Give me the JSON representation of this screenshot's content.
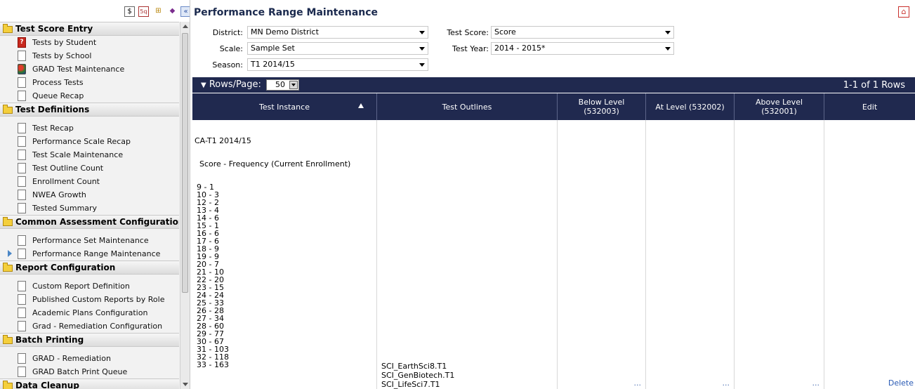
{
  "sidebar": {
    "toolbar": [
      {
        "icon": "dollar-icon",
        "glyph": "$"
      },
      {
        "icon": "report-icon",
        "glyph": "5q"
      },
      {
        "icon": "database-icon",
        "glyph": "⊞"
      },
      {
        "icon": "book-icon",
        "glyph": "◆"
      },
      {
        "icon": "collapse-icon",
        "glyph": "«"
      }
    ],
    "sections": [
      {
        "title": "Test Score Entry",
        "items": [
          "Tests by Student",
          "Tests by School",
          "GRAD Test Maintenance",
          "Process Tests",
          "Queue Recap"
        ]
      },
      {
        "title": "Test Definitions",
        "items": [
          "Test Recap",
          "Performance Scale Recap",
          "Test Scale Maintenance",
          "Test Outline Count",
          "Enrollment Count",
          "NWEA Growth",
          "Tested Summary"
        ]
      },
      {
        "title": "Common Assessment Configuration",
        "items": [
          "Performance Set Maintenance",
          "Performance Range Maintenance"
        ]
      },
      {
        "title": "Report Configuration",
        "items": [
          "Custom Report Definition",
          "Published Custom Reports by Role",
          "Academic Plans Configuration",
          "Grad - Remediation Configuration"
        ]
      },
      {
        "title": "Batch Printing",
        "items": [
          "GRAD - Remediation",
          "GRAD Batch Print Queue"
        ]
      },
      {
        "title": "Data Cleanup",
        "items": []
      }
    ]
  },
  "page": {
    "title": "Performance Range Maintenance"
  },
  "filters": {
    "district_label": "District:",
    "district_value": "MN Demo District",
    "scale_label": "Scale:",
    "scale_value": "Sample Set",
    "season_label": "Season:",
    "season_value": "T1 2014/15",
    "test_score_label": "Test Score:",
    "test_score_value": "Score",
    "test_year_label": "Test Year:",
    "test_year_value": "2014 - 2015*"
  },
  "grid": {
    "rows_label": "Rows/Page:",
    "rows_per_page": "50",
    "rows_count": "1-1 of 1 Rows",
    "columns": [
      "Test Instance",
      "Test Outlines",
      "Below Level\n(532003)",
      "At Level (532002)",
      "Above Level\n(532001)",
      "Edit"
    ],
    "row": {
      "test_instance": "CA-T1 2014/15",
      "score_heading": "  Score - Frequency (Current Enrollment)",
      "frequencies": [
        "9 - 1",
        "10 - 3",
        "12 - 2",
        "13 - 4",
        "14 - 6",
        "15 - 1",
        "16 - 6",
        "17 - 6",
        "18 - 9",
        "19 - 9",
        "20 - 7",
        "21 - 10",
        "22 - 20",
        "23 - 15",
        "24 - 24",
        "25 - 33",
        "26 - 28",
        "27 - 34",
        "28 - 60",
        "29 - 77",
        "30 - 67",
        "31 - 103",
        "32 - 118",
        "33 - 163"
      ],
      "test_outlines": [
        "SCI_EarthSci8.T1",
        "SCI_GenBiotech.T1",
        "SCI_LifeSci7.T1"
      ],
      "ellipsis": "...",
      "edit_action": "Delete"
    }
  }
}
